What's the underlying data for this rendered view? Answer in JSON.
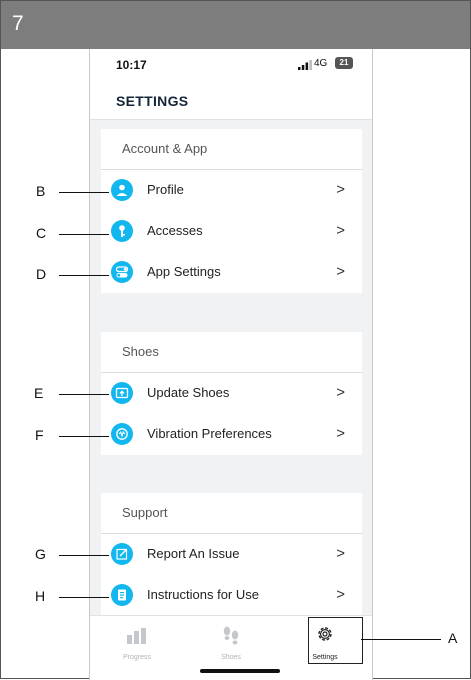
{
  "step": "7",
  "status": {
    "time": "10:17",
    "network": "4G",
    "battery": "21"
  },
  "title": "SETTINGS",
  "sections": [
    {
      "heading": "Account & App",
      "items": [
        {
          "label": "Profile",
          "icon": "user-icon"
        },
        {
          "label": "Accesses",
          "icon": "key-icon"
        },
        {
          "label": "App Settings",
          "icon": "toggle-icon"
        }
      ]
    },
    {
      "heading": "Shoes",
      "items": [
        {
          "label": "Update Shoes",
          "icon": "update-icon"
        },
        {
          "label": "Vibration Preferences",
          "icon": "vibration-icon"
        }
      ]
    },
    {
      "heading": "Support",
      "items": [
        {
          "label": "Report An Issue",
          "icon": "report-icon"
        },
        {
          "label": "Instructions for Use",
          "icon": "manual-icon"
        }
      ]
    }
  ],
  "chevron": ">",
  "tabs": [
    {
      "label": "Progress",
      "icon": "bar-chart-icon"
    },
    {
      "label": "Shoes",
      "icon": "footprint-icon"
    },
    {
      "label": "Settings",
      "icon": "gear-icon"
    }
  ],
  "callouts": [
    "A",
    "B",
    "C",
    "D",
    "E",
    "F",
    "G",
    "H"
  ],
  "colors": {
    "accent": "#13b7ef",
    "title": "#14263a",
    "step_bar": "#7d7d7d"
  }
}
